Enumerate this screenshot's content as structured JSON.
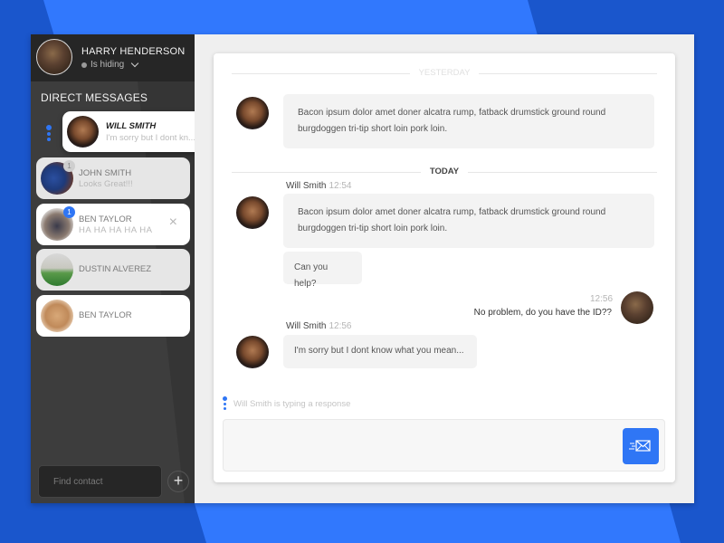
{
  "colors": {
    "background": "#1a56cc",
    "background_band": "#3178fd",
    "accent": "#2f76f5",
    "sidebar": "#3d3d3d",
    "sidebar_header": "#262626"
  },
  "profile": {
    "name": "HARRY HENDERSON",
    "status": "Is hiding"
  },
  "sidebar": {
    "title": "DIRECT MESSAGES",
    "contacts": [
      {
        "name": "WILL SMITH",
        "message": "I'm sorry but I dont kn...",
        "active": true
      },
      {
        "name": "JOHN SMITH",
        "message": "Looks Great!!!",
        "badge": "1"
      },
      {
        "name": "BEN TAYLOR",
        "message": "HA HA HA HA HA",
        "badge": "1",
        "close_icon": "×"
      },
      {
        "name": "DUSTIN ALVEREZ"
      },
      {
        "name": "BEN TAYLOR"
      }
    ],
    "search_placeholder": "Find contact",
    "add_label": "+"
  },
  "chat": {
    "dividers": {
      "yesterday": "YESTERDAY",
      "today": "TODAY"
    },
    "messages": [
      {
        "sender": "Will Smith",
        "time": "",
        "text": "Bacon ipsum dolor amet doner alcatra rump, fatback drumstick ground round burgdoggen tri-tip short loin pork loin."
      },
      {
        "sender": "Will Smith",
        "time": "12:54",
        "text": "Bacon ipsum dolor amet doner alcatra rump, fatback drumstick ground round burgdoggen tri-tip short loin pork loin."
      },
      {
        "sender": "Will Smith",
        "time": "",
        "text": "Can you help?"
      },
      {
        "sender": "Harry Henderson",
        "time": "12:56",
        "text": "No problem, do you have the ID??"
      },
      {
        "sender": "Will Smith",
        "time": "12:56",
        "text": "I'm sorry but I dont know what you mean..."
      }
    ],
    "typing_indicator": "Will Smith is typing a response",
    "composer_value": "",
    "send_icon": "send-mail-icon"
  }
}
